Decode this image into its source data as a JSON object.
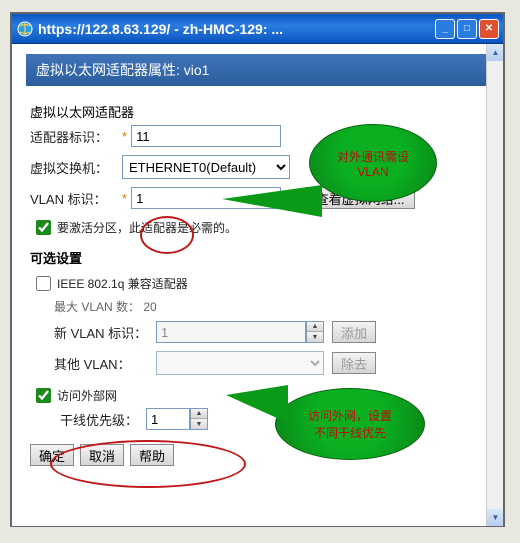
{
  "window": {
    "title": "https://122.8.63.129/ - zh-HMC-129: ...",
    "min": "_",
    "max": "□",
    "close": "✕"
  },
  "panelTitle": "虚拟以太网适配器属性: vio1",
  "section1Label": "虚拟以太网适配器",
  "adapterId": {
    "label": "适配器标识：",
    "value": "11"
  },
  "vswitch": {
    "label": "虚拟交换机：",
    "selected": "ETHERNET0(Default)"
  },
  "vlanId": {
    "label": "VLAN 标识：",
    "value": "1"
  },
  "viewVnet": "查看虚拟网络...",
  "activateRequired": {
    "checked": true,
    "text": "要激活分区，此适配器是必需的。"
  },
  "optionalTitle": "可选设置",
  "ieee8021q": {
    "checked": false,
    "text": "IEEE 802.1q 兼容适配器"
  },
  "maxVlan": {
    "label": "最大 VLAN 数：",
    "value": "20"
  },
  "newVlanId": {
    "label": "新 VLAN 标识：",
    "value": "1",
    "addBtn": "添加"
  },
  "otherVlan": {
    "label": "其他 VLAN：",
    "value": "",
    "removeBtn": "除去"
  },
  "accessExternal": {
    "checked": true,
    "text": "访问外部网"
  },
  "trunkPriority": {
    "label": "干线优先级：",
    "value": "1"
  },
  "buttons": {
    "ok": "确定",
    "cancel": "取消",
    "help": "帮助"
  },
  "callouts": {
    "c1a": "对外通讯需设",
    "c1b": "VLAN",
    "c2a": "访问外网，设置",
    "c2b": "不同干线优先"
  }
}
